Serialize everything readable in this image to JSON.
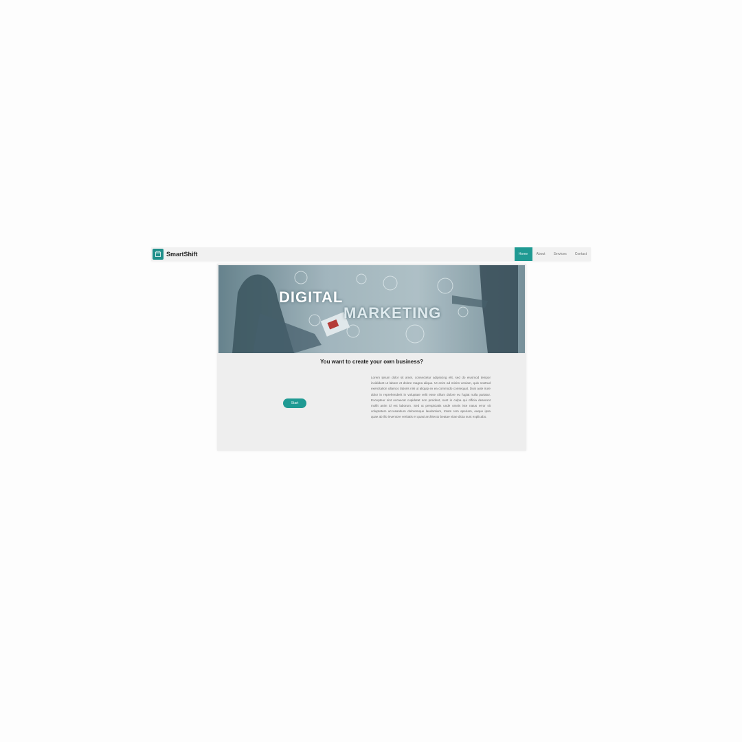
{
  "navbar": {
    "brand": "SmartShift",
    "links": [
      {
        "label": "Home",
        "active": true
      },
      {
        "label": "About",
        "active": false
      },
      {
        "label": "Services",
        "active": false
      },
      {
        "label": "Contact",
        "active": false
      }
    ],
    "icons": {
      "logo": "store-icon"
    }
  },
  "hero": {
    "line1": "DIGITAL",
    "line2": "MARKETING"
  },
  "main": {
    "question": "You want to create your own business?",
    "button_label": "Start",
    "paragraph": "Lorem ipsum dolor sit amet, consectetur adipiscing elit, sed do eiusmod tempor incididunt ut labore et dolore magna aliqua. Ut enim ad minim veniam, quis nostrud exercitation ullamco laboris nisi ut aliquip ex ea commodo consequat. Duis aute irure dolor in reprehenderit in voluptate velit esse cillum dolore eu fugiat nulla pariatur. Excepteur sint occaecat cupidatat non proident, sunt in culpa qui officia deserunt mollit anim id est laborum. Sed ut perspiciatis unde omnis iste natus error sit voluptatem accusantium doloremque laudantium, totam rem aperiam, eaque ipsa quae ab illo inventore veritatis et quasi architecto beatae vitae dicta sunt explicabo."
  },
  "colors": {
    "accent": "#1f9a93",
    "background": "#fdfdfd",
    "card": "#eeeeee",
    "navbar": "#f1f1f1"
  }
}
